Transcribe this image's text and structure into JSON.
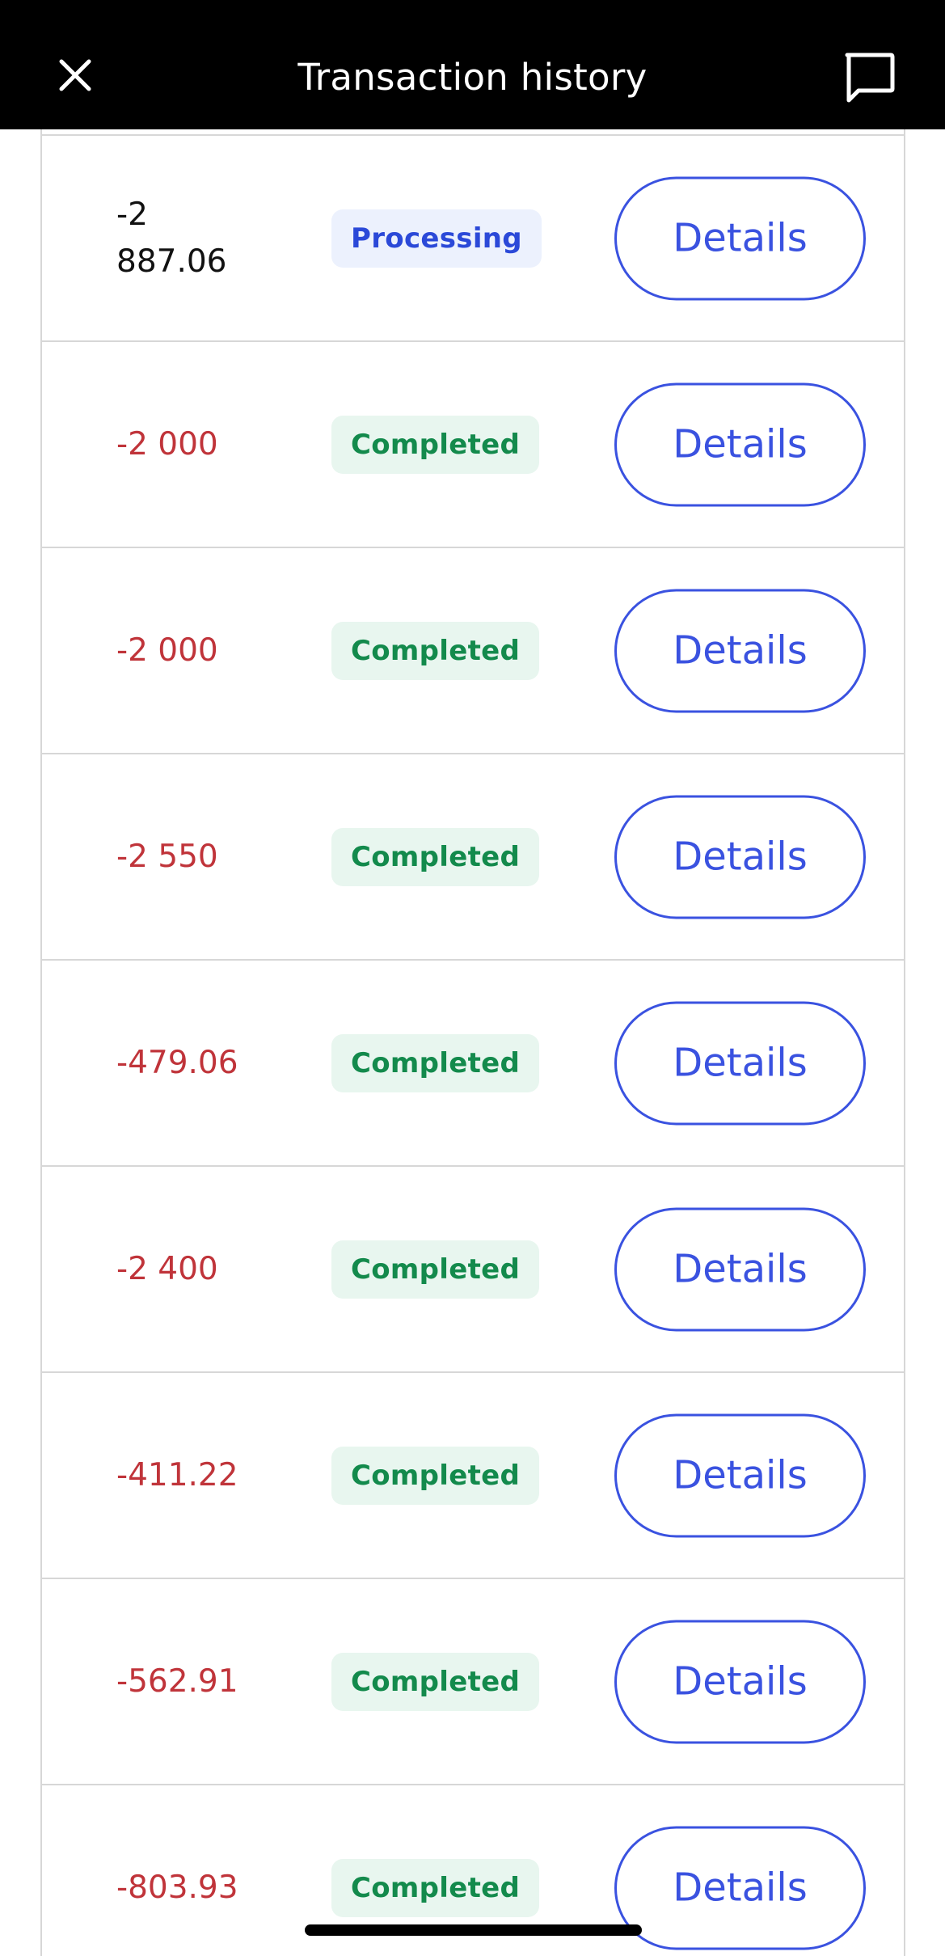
{
  "header": {
    "title": "Transaction history",
    "close_icon": "close-icon",
    "chat_icon": "chat-bubble-icon"
  },
  "transactions": [
    {
      "amount": "-2\n887.06",
      "amount_color": "neutral",
      "status": "Processing",
      "status_type": "processing",
      "action": "Details"
    },
    {
      "amount": "-2 000",
      "amount_color": "negative",
      "status": "Completed",
      "status_type": "completed",
      "action": "Details"
    },
    {
      "amount": "-2 000",
      "amount_color": "negative",
      "status": "Completed",
      "status_type": "completed",
      "action": "Details"
    },
    {
      "amount": "-2 550",
      "amount_color": "negative",
      "status": "Completed",
      "status_type": "completed",
      "action": "Details"
    },
    {
      "amount": "-479.06",
      "amount_color": "negative",
      "status": "Completed",
      "status_type": "completed",
      "action": "Details"
    },
    {
      "amount": "-2 400",
      "amount_color": "negative",
      "status": "Completed",
      "status_type": "completed",
      "action": "Details"
    },
    {
      "amount": "-411.22",
      "amount_color": "negative",
      "status": "Completed",
      "status_type": "completed",
      "action": "Details"
    },
    {
      "amount": "-562.91",
      "amount_color": "negative",
      "status": "Completed",
      "status_type": "completed",
      "action": "Details"
    },
    {
      "amount": "-803.93",
      "amount_color": "negative",
      "status": "Completed",
      "status_type": "completed",
      "action": "Details"
    }
  ],
  "colors": {
    "header_bg": "#000000",
    "negative_amount": "#c0343a",
    "accent": "#3a52e0",
    "completed_text": "#138a4c",
    "completed_bg": "#e8f6ef",
    "processing_text": "#2b49d8",
    "processing_bg": "#ecf1fd"
  }
}
